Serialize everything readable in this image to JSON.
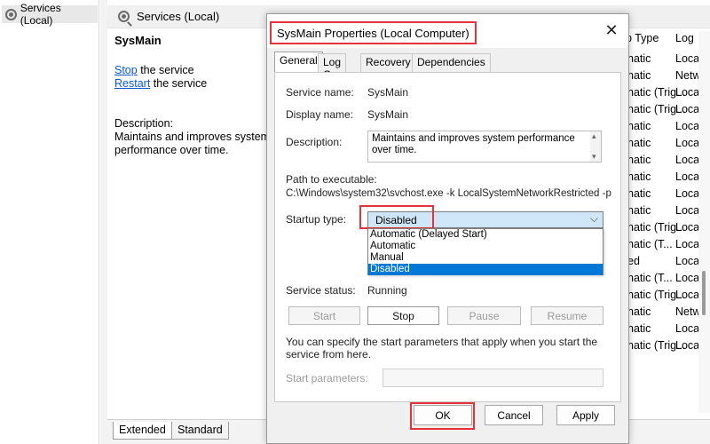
{
  "tree": {
    "item_label": "Services (Local)"
  },
  "main": {
    "header_title": "Services (Local)",
    "service_name": "SysMain",
    "stop_link": "Stop",
    "stop_suffix": " the service",
    "restart_link": "Restart",
    "restart_suffix": " the service",
    "description_label": "Description:",
    "description_text": "Maintains and improves system performance over time."
  },
  "columns": {
    "startup_type_header": "p Type",
    "log_on_header": "Log",
    "startup_cells": [
      "natic",
      "natic",
      "natic (Trig...",
      "natic (Trig...",
      "natic",
      "natic",
      "natic",
      "natic",
      "natic",
      "natic",
      "natic (Trig...",
      "natic (T...",
      "ed",
      "natic (T...",
      "natic (Trig...",
      "natic",
      "natic",
      "natic (Trig..."
    ],
    "logon_cells": [
      "Loca",
      "Netw",
      "Loca",
      "Loca",
      "Loca",
      "Loca",
      "Loca",
      "Loca",
      "Loca",
      "Loca",
      "Loca",
      "Loca",
      "Loca",
      "Loca",
      "Loca",
      "Netw",
      "Loca",
      "Loca"
    ]
  },
  "bottom_tabs": {
    "extended": "Extended",
    "standard": "Standard"
  },
  "dialog": {
    "title": "SysMain Properties (Local Computer)",
    "tabs": [
      "General",
      "Log On",
      "Recovery",
      "Dependencies"
    ],
    "service_name_label": "Service name:",
    "service_name_value": "SysMain",
    "display_name_label": "Display name:",
    "display_name_value": "SysMain",
    "description_label": "Description:",
    "description_value": "Maintains and improves system performance over time.",
    "path_label": "Path to executable:",
    "path_value": "C:\\Windows\\system32\\svchost.exe -k LocalSystemNetworkRestricted -p",
    "startup_type_label": "Startup type:",
    "startup_type_value": "Disabled",
    "startup_options": [
      "Automatic (Delayed Start)",
      "Automatic",
      "Manual",
      "Disabled"
    ],
    "startup_selected_option": "Disabled",
    "service_status_label": "Service status:",
    "service_status_value": "Running",
    "buttons": {
      "start": "Start",
      "stop": "Stop",
      "pause": "Pause",
      "resume": "Resume"
    },
    "hint_text": "You can specify the start parameters that apply when you start the service from here.",
    "start_params_label": "Start parameters:",
    "start_params_value": "",
    "ok": "OK",
    "cancel": "Cancel",
    "apply": "Apply"
  },
  "colors": {
    "highlight_box": "#e5323b",
    "selection": "#0078d7",
    "link": "#0b57d0"
  }
}
